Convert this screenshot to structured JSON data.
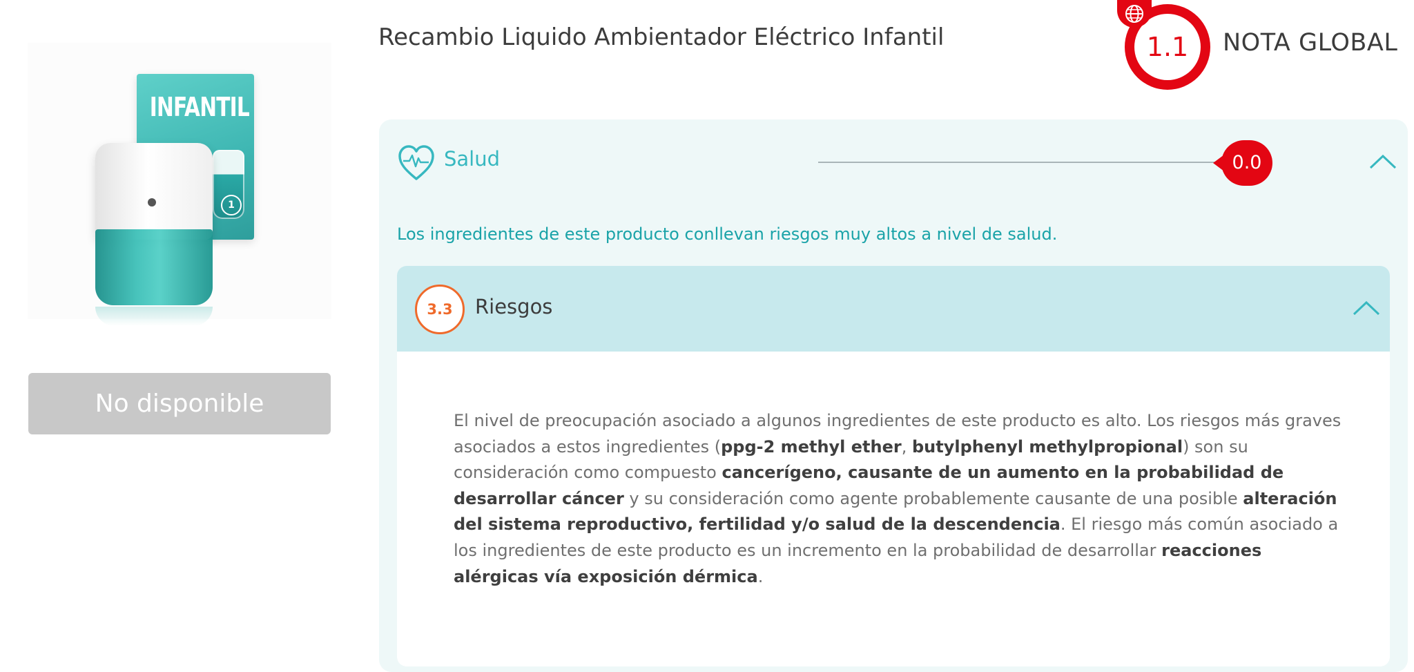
{
  "product": {
    "image_brand_text": "INFANTIL",
    "image_badge_text": "1",
    "unavailable_label": "No disponible"
  },
  "header": {
    "title": "Recambio Liquido Ambientador Eléctrico Infantil",
    "score": "1.1",
    "score_label": "NOTA GLOBAL",
    "score_color": "#e30613"
  },
  "health": {
    "label": "Salud",
    "score": "0.0",
    "icon": "heart-pulse-icon",
    "description": "Los ingredientes de este producto conllevan riesgos muy altos a nivel de salud.",
    "accent_color": "#37b8c0"
  },
  "risks": {
    "label": "Riesgos",
    "score": "3.3",
    "score_color": "#ef6a2b",
    "text": {
      "p1": "El nivel de preocupación asociado a algunos ingredientes de este producto es alto. Los riesgos más graves asociados a estos ingredientes (",
      "b1": "ppg-2 methyl ether",
      "p2": ", ",
      "b2": "butylphenyl methylpropional",
      "p3": ") son su consideración como compuesto ",
      "b3": "cancerígeno, causante de un aumento en la probabilidad de desarrollar cáncer",
      "p4": " y su consideración como agente probablemente causante de una posible ",
      "b4": "alteración del sistema reproductivo, fertilidad y/o salud de la descendencia",
      "p5": ". El riesgo más común asociado a los ingredientes de este producto es un incremento en la probabilidad de desarrollar ",
      "b5": "reacciones alérgicas vía exposición dérmica",
      "p6": "."
    }
  }
}
